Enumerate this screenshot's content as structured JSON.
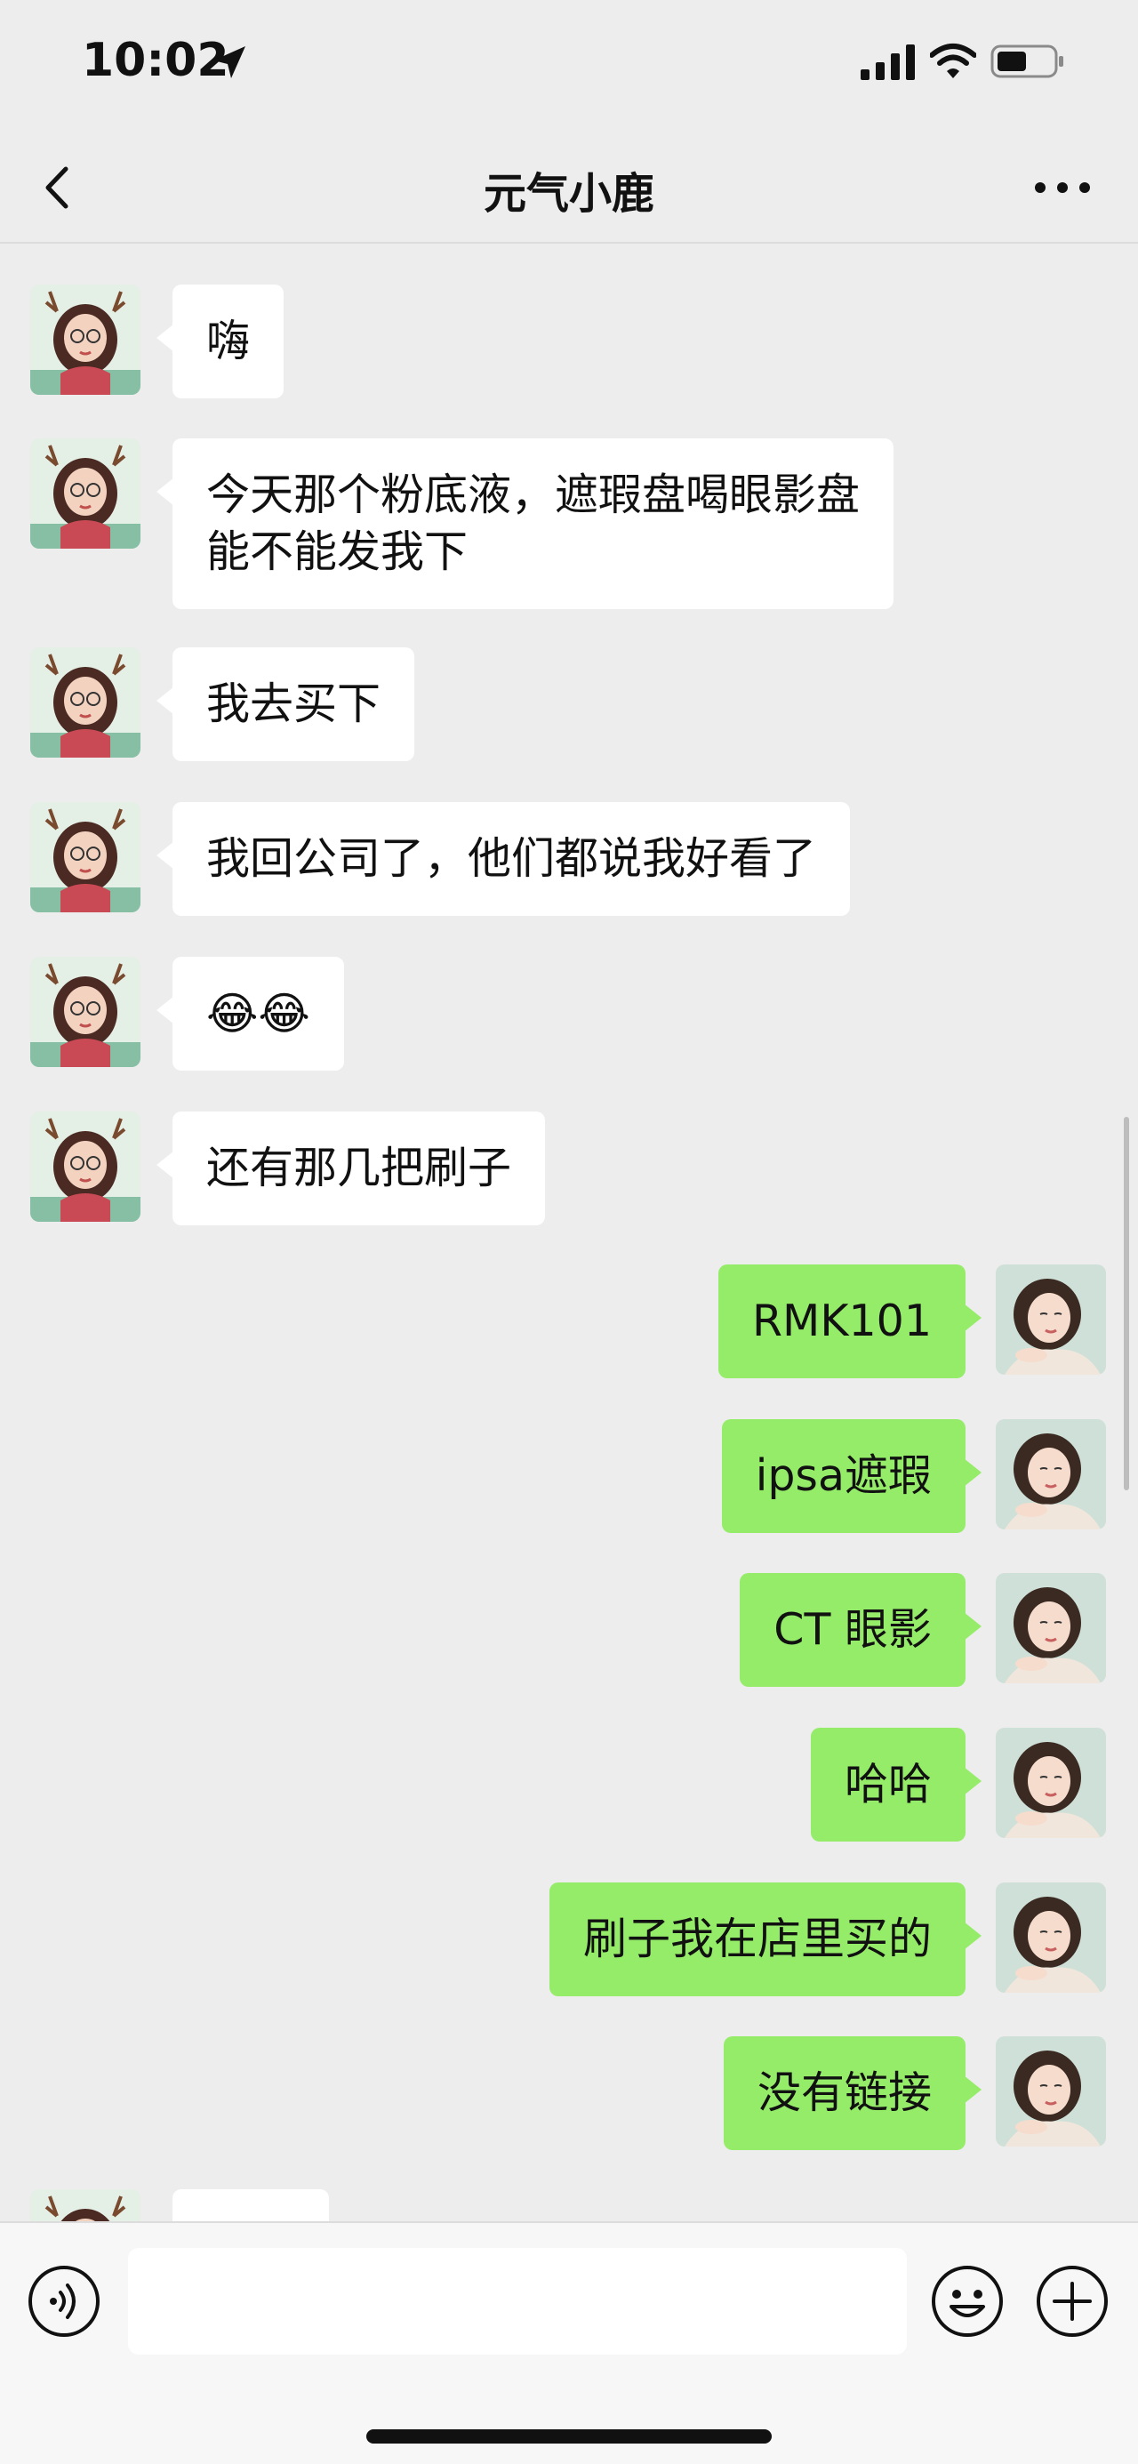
{
  "status_bar": {
    "time": "10:02",
    "icons": [
      "location-arrow-icon",
      "cellular-signal-icon",
      "wifi-icon",
      "battery-icon"
    ]
  },
  "nav": {
    "title": "元气小鹿",
    "left_icon": "chevron-left-icon",
    "right_icon": "more-dots-icon"
  },
  "colors": {
    "background": "#ededed",
    "incoming_bubble": "#ffffff",
    "outgoing_bubble": "#95ec69"
  },
  "messages": [
    {
      "direction": "in",
      "text": "嗨"
    },
    {
      "direction": "in",
      "text": "今天那个粉底液，遮瑕盘喝眼影盘\n能不能发我下"
    },
    {
      "direction": "in",
      "text": "我去买下"
    },
    {
      "direction": "in",
      "text": "我回公司了，他们都说我好看了"
    },
    {
      "direction": "in",
      "text": "😂😂"
    },
    {
      "direction": "in",
      "text": "还有那几把刷子"
    },
    {
      "direction": "out",
      "text": "RMK101"
    },
    {
      "direction": "out",
      "text": "ipsa遮瑕"
    },
    {
      "direction": "out",
      "text": "CT 眼影"
    },
    {
      "direction": "out",
      "text": "哈哈"
    },
    {
      "direction": "out",
      "text": "刷子我在店里买的"
    },
    {
      "direction": "out",
      "text": "没有链接"
    }
  ],
  "input_bar": {
    "voice_icon": "voice-icon",
    "input_value": "",
    "emoji_icon": "smiley-icon",
    "more_icon": "plus-circle-icon"
  }
}
